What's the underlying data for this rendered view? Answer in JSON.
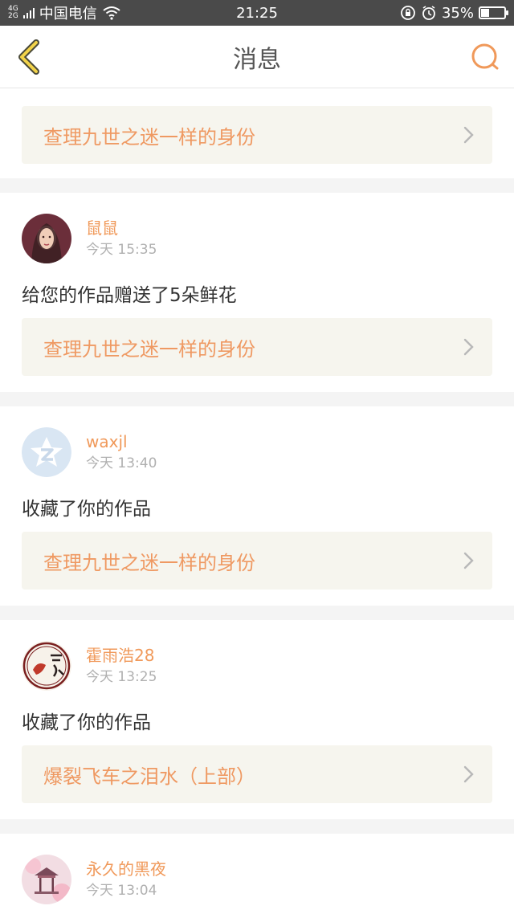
{
  "status_bar": {
    "network_top": "4G",
    "network_bottom": "2G",
    "carrier": "中国电信",
    "time": "21:25",
    "battery_percent": "35%",
    "battery_level": 0.35
  },
  "navbar": {
    "title": "消息"
  },
  "colors": {
    "accent": "#f0995a",
    "link_bg": "#f6f5ee",
    "status_bg": "#4a4a4a"
  },
  "top_link": {
    "title": "查理九世之迷一样的身份"
  },
  "messages": [
    {
      "user": "鼠鼠",
      "time": "今天 15:35",
      "text": "给您的作品赠送了5朵鲜花",
      "work": "查理九世之迷一样的身份",
      "avatar": "portrait"
    },
    {
      "user": "waxjl",
      "time": "今天 13:40",
      "text": "收藏了你的作品",
      "work": "查理九世之迷一样的身份",
      "avatar": "default-qq"
    },
    {
      "user": "霍雨浩28",
      "time": "今天 13:25",
      "text": "收藏了你的作品",
      "work": "爆裂飞车之泪水（上部）",
      "avatar": "seal"
    },
    {
      "user": "永久的黑夜",
      "time": "今天 13:04",
      "avatar": "pavilion"
    }
  ]
}
